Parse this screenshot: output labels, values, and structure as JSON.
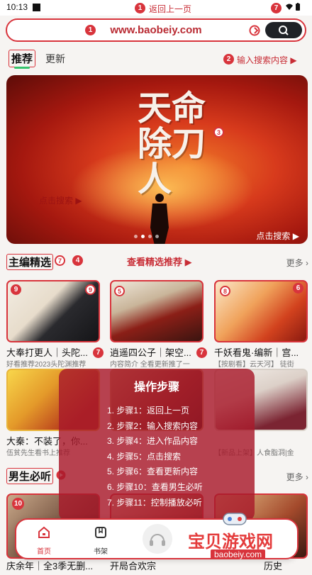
{
  "status": {
    "time": "10:13"
  },
  "annotations": {
    "back_top": "返回上一页",
    "input_search": "输入搜索内容"
  },
  "url_bar": {
    "url": "www.baobeiy.com"
  },
  "tabs": {
    "active": "推荐",
    "other": "更新"
  },
  "banner": {
    "title": "天命除刀人",
    "search_left": "点击搜索 ▶",
    "search_right": "点击搜索 ▶"
  },
  "section1": {
    "title": "主编精选",
    "link": "查看精选推荐 ▶",
    "more": "更多 ›"
  },
  "cards_row1": [
    {
      "title": "大奉打更人｜头陀...",
      "desc": "好看推荐2023头陀渊推荐"
    },
    {
      "title": "逍遥四公子｜架空...",
      "desc": "内容简介 全看更新推了一"
    },
    {
      "title": "千妖看鬼·编新｜宫...",
      "desc": "【按剧看】云天河】 徒街"
    }
  ],
  "cards_row2": [
    {
      "title": "大秦：不装了，你...",
      "desc": "伍贫先生看书上推荐"
    },
    {
      "title": "",
      "desc": ""
    },
    {
      "title": "",
      "desc": "【新品上架】人食脂洞|金"
    }
  ],
  "section2": {
    "title": "男生必听",
    "more": "更多 ›"
  },
  "cards_row3": [
    {
      "title": "庆余年｜全3季无删..."
    },
    {
      "title": "开局合欢宗"
    },
    {
      "title": "历史"
    }
  ],
  "overlay": {
    "title": "操作步骤",
    "steps": [
      "1. 步骤1：返回上一页",
      "2. 步骤2：输入搜索内容",
      "3. 步骤4：进入作品内容",
      "4. 步骤5：点击搜索",
      "5. 步骤6：查看更新内容",
      "6. 步骤10：查看男生必听",
      "7. 步骤11：控制播放必听"
    ]
  },
  "bottom_nav": {
    "home": "首页",
    "shelf": "书架"
  },
  "watermark": {
    "text": "宝贝游戏网",
    "url": "baobeiy.com"
  }
}
